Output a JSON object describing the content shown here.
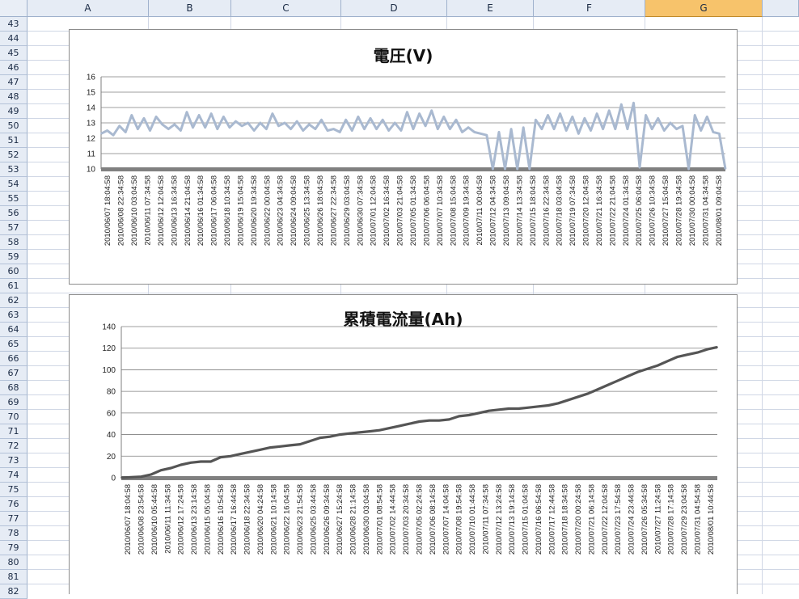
{
  "spreadsheet": {
    "columns": [
      {
        "label": "A",
        "selected": false
      },
      {
        "label": "B",
        "selected": false
      },
      {
        "label": "C",
        "selected": false
      },
      {
        "label": "D",
        "selected": false
      },
      {
        "label": "E",
        "selected": false
      },
      {
        "label": "F",
        "selected": false
      },
      {
        "label": "G",
        "selected": true
      },
      {
        "label": "",
        "selected": false
      }
    ],
    "rows": [
      "43",
      "44",
      "45",
      "46",
      "47",
      "48",
      "49",
      "50",
      "51",
      "52",
      "53",
      "54",
      "55",
      "56",
      "57",
      "58",
      "59",
      "60",
      "61",
      "62",
      "63",
      "64",
      "65",
      "66",
      "67",
      "68",
      "69",
      "70",
      "71",
      "72",
      "73",
      "74",
      "75",
      "76",
      "77",
      "78",
      "79",
      "80",
      "81",
      "82"
    ],
    "colors": {
      "header_bg": "#e6ecf5",
      "selected_header": "#f7c36b",
      "grid_line": "#d0d7e5"
    }
  },
  "chart_data": [
    {
      "type": "line",
      "title": "電圧(V)",
      "xlabel": "",
      "ylabel": "",
      "ylim": [
        10,
        16
      ],
      "yticks": [
        10,
        11,
        12,
        13,
        14,
        15,
        16
      ],
      "grid": true,
      "line_color": "#a9b9d0",
      "categories": [
        "2010/06/07 18:04:58",
        "2010/06/08 22:34:58",
        "2010/06/10 03:04:58",
        "2010/06/11 07:34:58",
        "2010/06/12 12:04:58",
        "2010/06/13 16:34:58",
        "2010/06/14 21:04:58",
        "2010/06/16 01:34:58",
        "2010/06/17 06:04:58",
        "2010/06/18 10:34:58",
        "2010/06/19 15:04:58",
        "2010/06/20 19:34:58",
        "2010/06/22 00:04:58",
        "2010/06/23 04:34:58",
        "2010/06/24 09:04:58",
        "2010/06/25 13:34:58",
        "2010/06/26 18:04:58",
        "2010/06/27 22:34:58",
        "2010/06/29 03:04:58",
        "2010/06/30 07:34:58",
        "2010/07/01 12:04:58",
        "2010/07/02 16:34:58",
        "2010/07/03 21:04:58",
        "2010/07/05 01:34:58",
        "2010/07/06 06:04:58",
        "2010/07/07 10:34:58",
        "2010/07/08 15:04:58",
        "2010/07/09 19:34:58",
        "2010/07/11 00:04:58",
        "2010/07/12 04:34:58",
        "2010/07/13 09:04:58",
        "2010/07/14 13:34:58",
        "2010/07/15 18:04:58",
        "2010/07/16 22:34:58",
        "2010/07/18 03:04:58",
        "2010/07/19 07:34:58",
        "2010/07/20 12:04:58",
        "2010/07/21 16:34:58",
        "2010/07/22 21:04:58",
        "2010/07/24 01:34:58",
        "2010/07/25 06:04:58",
        "2010/07/26 10:34:58",
        "2010/07/27 15:04:58",
        "2010/07/28 19:34:58",
        "2010/07/30 00:04:58",
        "2010/07/31 04:34:58",
        "2010/08/01 09:04:58"
      ],
      "series": [
        {
          "name": "",
          "values": [
            12.3,
            12.5,
            12.2,
            12.8,
            12.4,
            13.5,
            12.6,
            13.3,
            12.5,
            13.4,
            12.9,
            12.6,
            12.9,
            12.5,
            13.7,
            12.7,
            13.5,
            12.7,
            13.6,
            12.6,
            13.4,
            12.7,
            13.1,
            12.8,
            13.0,
            12.5,
            13.0,
            12.6,
            13.6,
            12.8,
            13.0,
            12.6,
            13.1,
            12.5,
            12.9,
            12.6,
            13.2,
            12.5,
            12.6,
            12.4,
            13.2,
            12.5,
            13.4,
            12.6,
            13.3,
            12.6,
            13.2,
            12.5,
            13.0,
            12.5,
            13.7,
            12.6,
            13.6,
            12.8,
            13.8,
            12.6,
            13.4,
            12.6,
            13.2,
            12.4,
            12.7,
            12.4,
            12.3,
            12.2,
            10.0,
            12.4,
            10.0,
            12.6,
            10.0,
            12.7,
            10.0,
            13.2,
            12.6,
            13.5,
            12.6,
            13.6,
            12.5,
            13.4,
            12.3,
            13.3,
            12.5,
            13.6,
            12.6,
            13.8,
            12.6,
            14.2,
            12.6,
            14.3,
            10.1,
            13.5,
            12.6,
            13.3,
            12.5,
            13.0,
            12.6,
            12.8,
            10.0,
            13.5,
            12.5,
            13.4,
            12.4,
            12.3,
            10.0
          ]
        }
      ]
    },
    {
      "type": "line",
      "title": "累積電流量(Ah)",
      "xlabel": "",
      "ylabel": "",
      "ylim": [
        0,
        140
      ],
      "yticks": [
        0,
        20,
        40,
        60,
        80,
        100,
        120,
        140
      ],
      "grid": true,
      "line_color": "#555555",
      "categories": [
        "2010/06/07 18:04:58",
        "2010/06/08 23:54:58",
        "2010/06/10 05:44:58",
        "2010/06/11 11:34:58",
        "2010/06/12 17:24:58",
        "2010/06/13 23:14:58",
        "2010/06/15 05:04:58",
        "2010/06/16 10:54:58",
        "2010/06/17 16:44:58",
        "2010/06/18 22:34:58",
        "2010/06/20 04:24:58",
        "2010/06/21 10:14:58",
        "2010/06/22 16:04:58",
        "2010/06/23 21:54:58",
        "2010/06/25 03:44:58",
        "2010/06/26 09:34:58",
        "2010/06/27 15:24:58",
        "2010/06/28 21:14:58",
        "2010/06/30 03:04:58",
        "2010/07/01 08:54:58",
        "2010/07/02 14:44:58",
        "2010/07/03 20:34:58",
        "2010/07/05 02:24:58",
        "2010/07/06 08:14:58",
        "2010/07/07 14:04:58",
        "2010/07/08 19:54:58",
        "2010/07/10 01:44:58",
        "2010/07/11 07:34:58",
        "2010/07/12 13:24:58",
        "2010/07/13 19:14:58",
        "2010/07/15 01:04:58",
        "2010/07/16 06:54:58",
        "2010/07/17 12:44:58",
        "2010/07/18 18:34:58",
        "2010/07/20 00:24:58",
        "2010/07/21 06:14:58",
        "2010/07/22 12:04:58",
        "2010/07/23 17:54:58",
        "2010/07/24 23:44:58",
        "2010/07/26 05:34:58",
        "2010/07/27 11:24:58",
        "2010/07/28 17:14:58",
        "2010/07/29 23:04:58",
        "2010/07/31 04:54:58",
        "2010/08/01 10:44:58"
      ],
      "series": [
        {
          "name": "",
          "values": [
            0,
            0.5,
            1,
            3,
            7,
            9,
            12,
            14,
            15,
            15,
            19,
            20,
            22,
            24,
            26,
            28,
            29,
            30,
            31,
            34,
            37,
            38,
            40,
            41,
            42,
            43,
            44,
            46,
            48,
            50,
            52,
            53,
            53,
            54,
            57,
            58,
            60,
            62,
            63,
            64,
            64,
            65,
            66,
            67,
            69,
            72,
            75,
            78,
            82,
            86,
            90,
            94,
            98,
            101,
            104,
            108,
            112,
            114,
            116,
            119,
            121
          ]
        }
      ]
    }
  ]
}
